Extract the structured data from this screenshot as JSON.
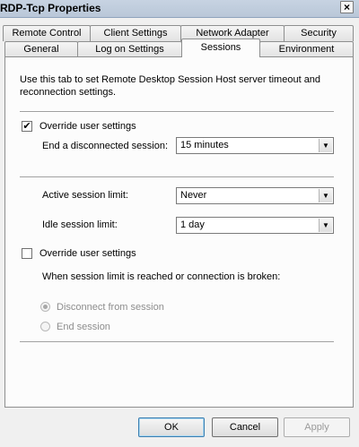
{
  "window": {
    "title": "RDP-Tcp Properties",
    "close_glyph": "×"
  },
  "tabs_back": [
    "Remote Control",
    "Client Settings",
    "Network Adapter",
    "Security"
  ],
  "tabs_front": [
    "General",
    "Log on Settings",
    "Sessions",
    "Environment"
  ],
  "active_tab": "Sessions",
  "description": "Use this tab to set Remote Desktop Session Host server timeout and reconnection settings.",
  "override1": {
    "label": "Override user settings",
    "checked": true
  },
  "disconnected": {
    "label": "End a disconnected session:",
    "value": "15 minutes"
  },
  "active_limit": {
    "label": "Active session limit:",
    "value": "Never"
  },
  "idle_limit": {
    "label": "Idle session limit:",
    "value": "1 day"
  },
  "override2": {
    "label": "Override user settings",
    "checked": false
  },
  "limit_text": "When session limit is reached or connection is broken:",
  "radio_options": [
    {
      "label": "Disconnect from session",
      "selected": true
    },
    {
      "label": "End session",
      "selected": false
    }
  ],
  "buttons": {
    "ok": "OK",
    "cancel": "Cancel",
    "apply": "Apply"
  },
  "glyphs": {
    "check": "✔",
    "dropdown": "▼"
  }
}
